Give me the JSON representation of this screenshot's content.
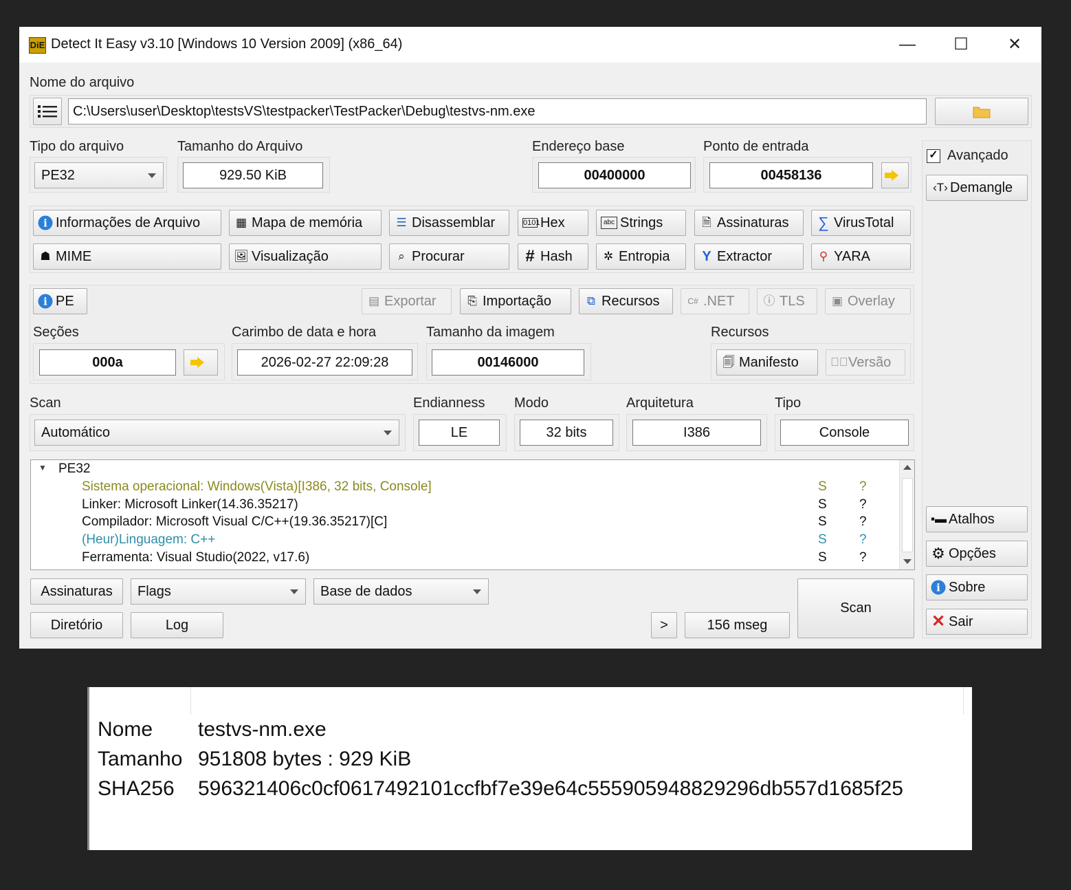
{
  "window": {
    "title": "Detect It Easy v3.10 [Windows 10 Version 2009] (x86_64)",
    "icon_text": "DiE",
    "controls": {
      "minimize": "—",
      "maximize": "☐",
      "close": "✕"
    }
  },
  "file": {
    "label": "Nome do arquivo",
    "path": "C:\\Users\\user\\Desktop\\testsVS\\testpacker\\TestPacker\\Debug\\testvs-nm.exe"
  },
  "info": {
    "tipo_label": "Tipo do arquivo",
    "tipo_value": "PE32",
    "tamanho_label": "Tamanho do Arquivo",
    "tamanho_value": "929.50 KiB",
    "base_label": "Endereço base",
    "base_value": "00400000",
    "entry_label": "Ponto de entrada",
    "entry_value": "00458136"
  },
  "side": {
    "avancado": "Avançado",
    "demangle": "Demangle",
    "atalhos": "Atalhos",
    "opcoes": "Opções",
    "sobre": "Sobre",
    "sair": "Sair"
  },
  "tools": {
    "info_arquivo": "Informações de Arquivo",
    "mapa": "Mapa de memória",
    "disassemblar": "Disassemblar",
    "hex": "Hex",
    "strings": "Strings",
    "assinaturas": "Assinaturas",
    "virustotal": "VirusTotal",
    "mime": "MIME",
    "visualizacao": "Visualização",
    "procurar": "Procurar",
    "hash": "Hash",
    "entropia": "Entropia",
    "extractor": "Extractor",
    "yara": "YARA"
  },
  "pe": {
    "pe_button": "PE",
    "exportar": "Exportar",
    "importacao": "Importação",
    "recursos_btn": "Recursos",
    "net": ".NET",
    "tls": "TLS",
    "overlay": "Overlay",
    "secoes_label": "Seções",
    "secoes_value": "000a",
    "carimbo_label": "Carimbo de data e hora",
    "carimbo_value": "2026-02-27 22:09:28",
    "imagem_label": "Tamanho da imagem",
    "imagem_value": "00146000",
    "recursos_label": "Recursos",
    "manifesto": "Manifesto",
    "versao": "Versão"
  },
  "scan": {
    "scan_label": "Scan",
    "scan_value": "Automático",
    "endianness_label": "Endianness",
    "endianness_value": "LE",
    "modo_label": "Modo",
    "modo_value": "32 bits",
    "arquitetura_label": "Arquitetura",
    "arquitetura_value": "I386",
    "tipo_label": "Tipo",
    "tipo_value": "Console"
  },
  "results": {
    "root": "PE32",
    "rows": [
      {
        "text": "Sistema operacional: Windows(Vista)[I386, 32 bits, Console]",
        "s": "S",
        "q": "?",
        "color": "#8a8a1e"
      },
      {
        "text": "Linker: Microsoft Linker(14.36.35217)",
        "s": "S",
        "q": "?",
        "color": "#111111"
      },
      {
        "text": "Compilador: Microsoft Visual C/C++(19.36.35217)[C]",
        "s": "S",
        "q": "?",
        "color": "#111111"
      },
      {
        "text": "(Heur)Linguagem: C++",
        "s": "S",
        "q": "?",
        "color": "#2e8fa8"
      },
      {
        "text": "Ferramenta: Visual Studio(2022, v17.6)",
        "s": "S",
        "q": "?",
        "color": "#111111"
      }
    ]
  },
  "bottom": {
    "assinaturas": "Assinaturas",
    "flags": "Flags",
    "base_dados": "Base de dados",
    "diretorio": "Diretório",
    "log": "Log",
    "more": ">",
    "time": "156 mseg",
    "scan": "Scan"
  },
  "card": {
    "nome_label": "Nome",
    "nome_value": "testvs-nm.exe",
    "tamanho_label": "Tamanho",
    "tamanho_value": "951808 bytes : 929 KiB",
    "sha_label": "SHA256",
    "sha_value": "596321406c0cf0617492101ccfbf7e39e64c555905948829296db557d1685f25"
  }
}
